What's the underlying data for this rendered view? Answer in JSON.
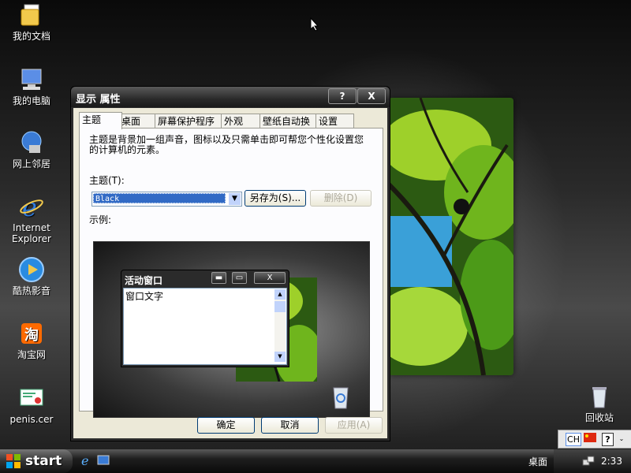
{
  "desktop": {
    "icons": [
      {
        "label": "我的文档",
        "icon": "my-documents-icon"
      },
      {
        "label": "我的电脑",
        "icon": "my-computer-icon"
      },
      {
        "label": "网上邻居",
        "icon": "network-places-icon"
      },
      {
        "label": "Internet Explorer",
        "icon": "internet-explorer-icon"
      },
      {
        "label": "酷热影音",
        "icon": "media-player-icon"
      },
      {
        "label": "淘宝网",
        "icon": "taobao-icon"
      },
      {
        "label": "penis.cer",
        "icon": "certificate-file-icon"
      },
      {
        "label": "回收站",
        "icon": "recycle-bin-icon"
      }
    ]
  },
  "dialog": {
    "title": "显示 属性",
    "title_buttons": {
      "help": "?",
      "close": "X"
    },
    "tabs": [
      {
        "label": "主题",
        "active": true
      },
      {
        "label": "桌面"
      },
      {
        "label": "屏幕保护程序"
      },
      {
        "label": "外观"
      },
      {
        "label": "壁纸自动换"
      },
      {
        "label": "设置"
      }
    ],
    "description": "主题是背景加一组声音，图标以及只需单击即可帮您个性化设置您的计算机的元素。",
    "theme_label": "主题(T):",
    "theme_value": "Black",
    "save_as_button": "另存为(S)...",
    "delete_button": "删除(D)",
    "sample_label": "示例:",
    "preview": {
      "window_title": "活动窗口",
      "window_text": "窗口文字",
      "buttons": {
        "minimize": "▬",
        "maximize": "▭",
        "close": "X"
      }
    },
    "ok_button": "确定",
    "cancel_button": "取消",
    "apply_button": "应用(A)"
  },
  "taskbar": {
    "start_label": "start",
    "quick_launch": [
      "internet-explorer-icon",
      "show-desktop-icon"
    ],
    "desktop_toolbar": "桌面",
    "clock": "2:33"
  },
  "language_bar": {
    "lang": "CH",
    "help": "?"
  },
  "colors": {
    "title_bar": "#2a2a2a",
    "selection": "#316ac5",
    "dialog_face": "#ece9d8"
  }
}
